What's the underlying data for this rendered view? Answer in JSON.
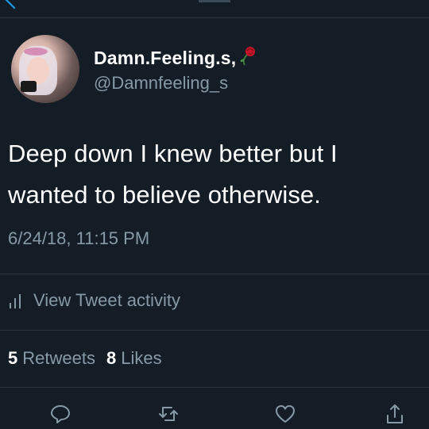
{
  "tweet": {
    "author": {
      "display_name": "Damn.Feeling.s,",
      "handle": "@Damnfeeling_s"
    },
    "text_line1": "Deep down I knew better but I",
    "text_line2": "wanted to believe otherwise.",
    "timestamp": "6/24/18, 11:15 PM",
    "activity_label": "View Tweet activity",
    "retweets_count": "5",
    "retweets_label": "Retweets",
    "likes_count": "8",
    "likes_label": "Likes"
  },
  "icons": {
    "back": "back-chevron-icon",
    "rose": "rose-emoji-icon",
    "activity": "bar-chart-icon",
    "reply": "reply-icon",
    "retweet": "retweet-icon",
    "like": "heart-icon",
    "share": "share-icon"
  },
  "colors": {
    "background": "#141d26",
    "accent": "#1da1f2",
    "secondary_text": "#8899a6",
    "divider": "#2a3642"
  }
}
